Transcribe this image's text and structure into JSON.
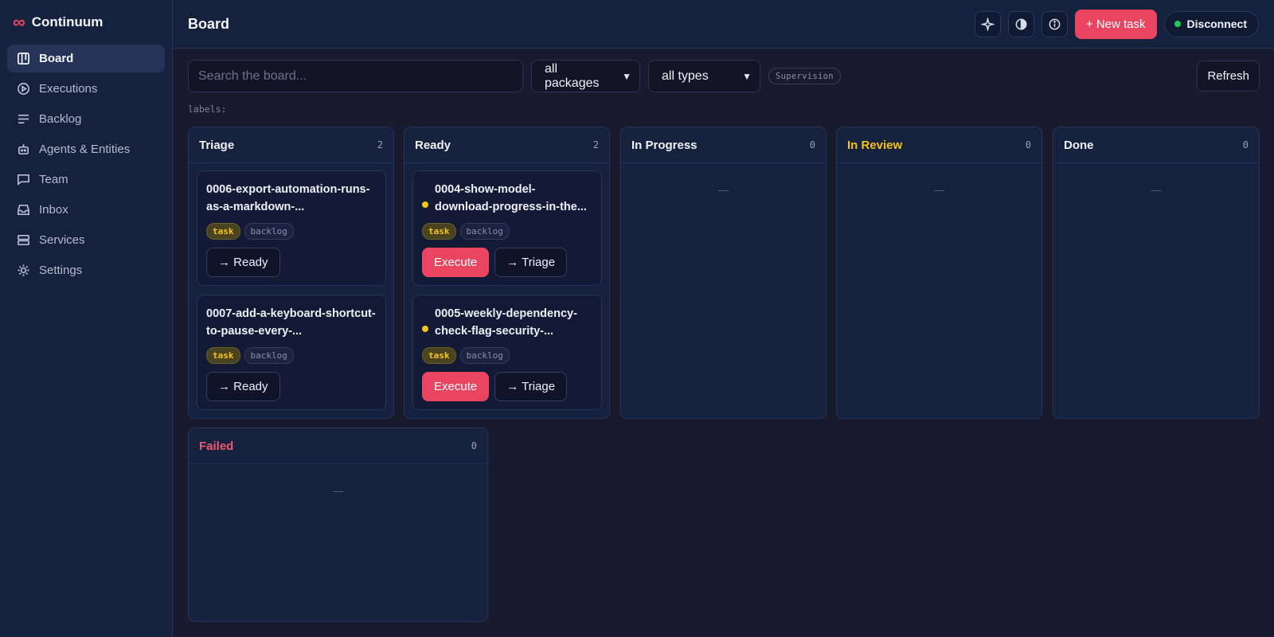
{
  "app": {
    "name": "Continuum",
    "logo_icon": "infinity-icon"
  },
  "sidebar": {
    "items": [
      {
        "label": "Board",
        "icon": "board-icon",
        "active": true
      },
      {
        "label": "Executions",
        "icon": "play-circle-icon"
      },
      {
        "label": "Backlog",
        "icon": "list-icon"
      },
      {
        "label": "Agents & Entities",
        "icon": "robot-icon"
      },
      {
        "label": "Team",
        "icon": "chat-icon"
      },
      {
        "label": "Inbox",
        "icon": "inbox-icon"
      },
      {
        "label": "Services",
        "icon": "server-icon"
      },
      {
        "label": "Settings",
        "icon": "gear-icon"
      }
    ]
  },
  "header": {
    "title": "Board",
    "new_task_label": "+ New task",
    "disconnect_label": "Disconnect",
    "icons": [
      "sparkle-icon",
      "contrast-icon",
      "info-icon"
    ]
  },
  "toolbar": {
    "search_placeholder": "Search the board...",
    "packages_value": "all packages",
    "types_value": "all types",
    "supervision_chip": "Supervision",
    "refresh_label": "Refresh",
    "labels_text": "labels:"
  },
  "columns": {
    "triage": {
      "title": "Triage",
      "count": "2"
    },
    "ready": {
      "title": "Ready",
      "count": "2"
    },
    "in_progress": {
      "title": "In Progress",
      "count": "0",
      "empty": "—"
    },
    "in_review": {
      "title": "In Review",
      "count": "0",
      "empty": "—"
    },
    "done": {
      "title": "Done",
      "count": "0",
      "empty": "—"
    },
    "failed": {
      "title": "Failed",
      "count": "0",
      "empty": "—"
    }
  },
  "cards": {
    "triage": [
      {
        "title": "0006-export-automation-runs-as-a-markdown-...",
        "tag_type": "task",
        "tag_status": "backlog",
        "action": "→ Ready"
      },
      {
        "title": "0007-add-a-keyboard-shortcut-to-pause-every-...",
        "tag_type": "task",
        "tag_status": "backlog",
        "action": "→ Ready"
      }
    ],
    "ready": [
      {
        "title": "0004-show-model-download-progress-in-the...",
        "tag_type": "task",
        "tag_status": "backlog",
        "execute": "Execute",
        "action": "→ Triage"
      },
      {
        "title": "0005-weekly-dependency-check-flag-security-...",
        "tag_type": "task",
        "tag_status": "backlog",
        "execute": "Execute",
        "action": "→ Triage"
      }
    ]
  },
  "colors": {
    "accent": "#e94560",
    "review": "#f5c518",
    "failed": "#f0596c",
    "connected": "#22c55e"
  }
}
